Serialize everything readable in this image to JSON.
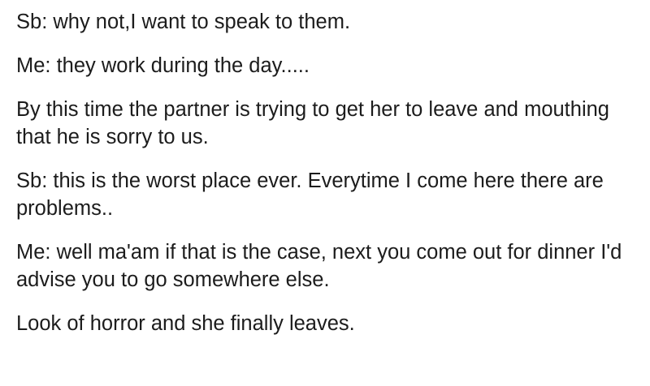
{
  "post": {
    "paragraphs": [
      "Sb: why not,I want to speak to them.",
      "Me: they work during the day.....",
      "By this time the partner is trying to get her to leave and mouthing that he is sorry to us.",
      "Sb: this is the worst place ever. Everytime I come here there are problems..",
      "Me: well ma'am if that is the case, next you come out for dinner I'd advise you to go somewhere else.",
      "Look of horror and she finally leaves."
    ]
  }
}
